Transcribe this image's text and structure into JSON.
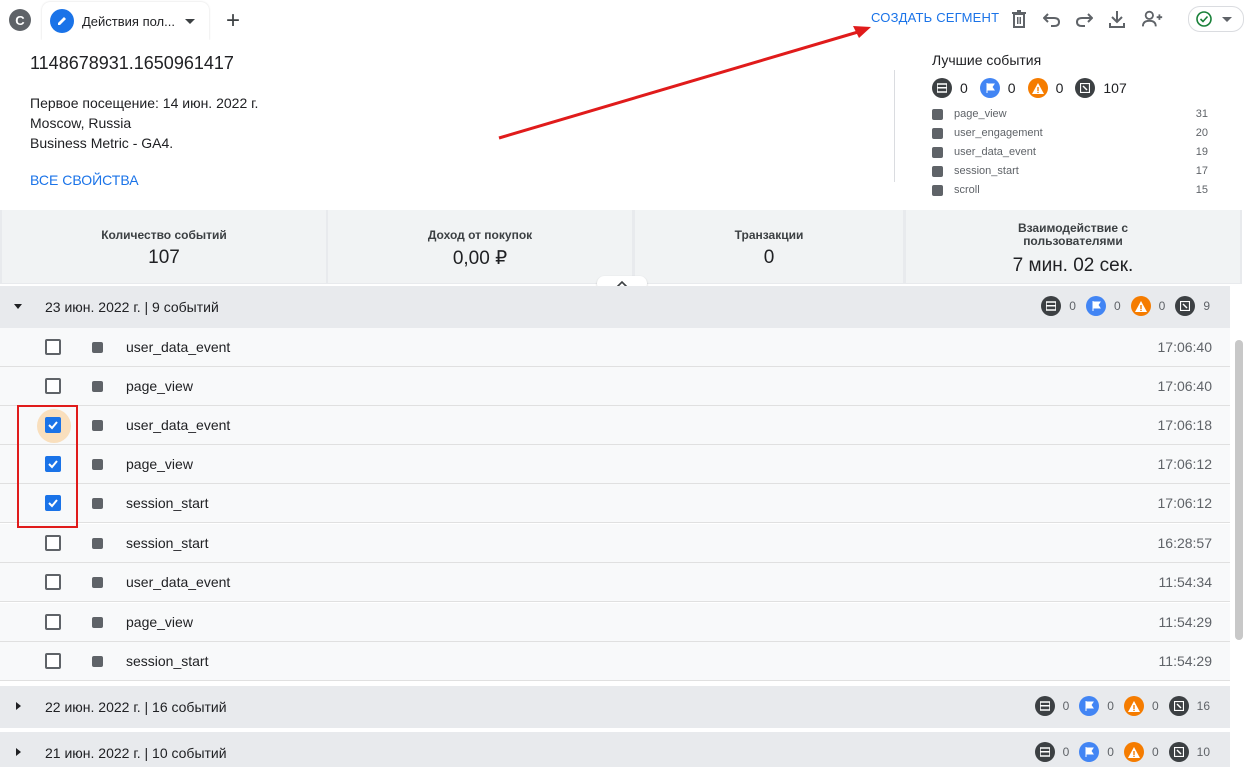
{
  "browser": {
    "profile_initial": "C",
    "tab_label": "Действия пол...",
    "new_tab_symbol": "+"
  },
  "toolbar": {
    "create_segment_label": "СОЗДАТЬ СЕГМЕНТ",
    "icons": [
      "delete-icon",
      "undo-icon",
      "redo-icon",
      "download-icon",
      "share-icon",
      "check-circle-icon"
    ]
  },
  "user": {
    "id": "1148678931.1650961417",
    "first_visit": "Первое посещение: 14 июн. 2022 г.",
    "location": "Moscow, Russia",
    "property": "Business Metric - GA4.",
    "all_properties_link": "ВСЕ СВОЙСТВА"
  },
  "best_events": {
    "title": "Лучшие события",
    "counts": {
      "conversions": "0",
      "flags": "0",
      "errors": "0",
      "events": "107"
    },
    "items": [
      {
        "name": "page_view",
        "count": "31"
      },
      {
        "name": "user_engagement",
        "count": "20"
      },
      {
        "name": "user_data_event",
        "count": "19"
      },
      {
        "name": "session_start",
        "count": "17"
      },
      {
        "name": "scroll",
        "count": "15"
      }
    ]
  },
  "stats": [
    {
      "label": "Количество событий",
      "value": "107"
    },
    {
      "label": "Доход от покупок",
      "value": "0,00 ₽"
    },
    {
      "label": "Транзакции",
      "value": "0"
    },
    {
      "label": "Взаимодействие с пользователями",
      "value": "7 мин. 02 сек."
    }
  ],
  "days": [
    {
      "title": "23 июн. 2022 г. | 9 событий",
      "expanded": true,
      "counts": {
        "conversions": "0",
        "flags": "0",
        "errors": "0",
        "events": "9"
      },
      "events": [
        {
          "name": "user_data_event",
          "time": "17:06:40",
          "checked": false
        },
        {
          "name": "page_view",
          "time": "17:06:40",
          "checked": false
        },
        {
          "name": "user_data_event",
          "time": "17:06:18",
          "checked": true
        },
        {
          "name": "page_view",
          "time": "17:06:12",
          "checked": true
        },
        {
          "name": "session_start",
          "time": "17:06:12",
          "checked": true
        },
        {
          "name": "session_start",
          "time": "16:28:57",
          "checked": false
        },
        {
          "name": "user_data_event",
          "time": "11:54:34",
          "checked": false
        },
        {
          "name": "page_view",
          "time": "11:54:29",
          "checked": false
        },
        {
          "name": "session_start",
          "time": "11:54:29",
          "checked": false
        }
      ]
    },
    {
      "title": "22 июн. 2022 г. | 16 событий",
      "expanded": false,
      "counts": {
        "conversions": "0",
        "flags": "0",
        "errors": "0",
        "events": "16"
      }
    },
    {
      "title": "21 июн. 2022 г. | 10 событий",
      "expanded": false,
      "counts": {
        "conversions": "0",
        "flags": "0",
        "errors": "0",
        "events": "10"
      }
    }
  ],
  "colors": {
    "accent": "#1a73e8",
    "conversion_icon": "#3c4043",
    "flag_icon": "#4285f4",
    "error_icon": "#f57c00",
    "annotation": "#e01b1b",
    "checkbox_focus": "#f9dfbd"
  }
}
